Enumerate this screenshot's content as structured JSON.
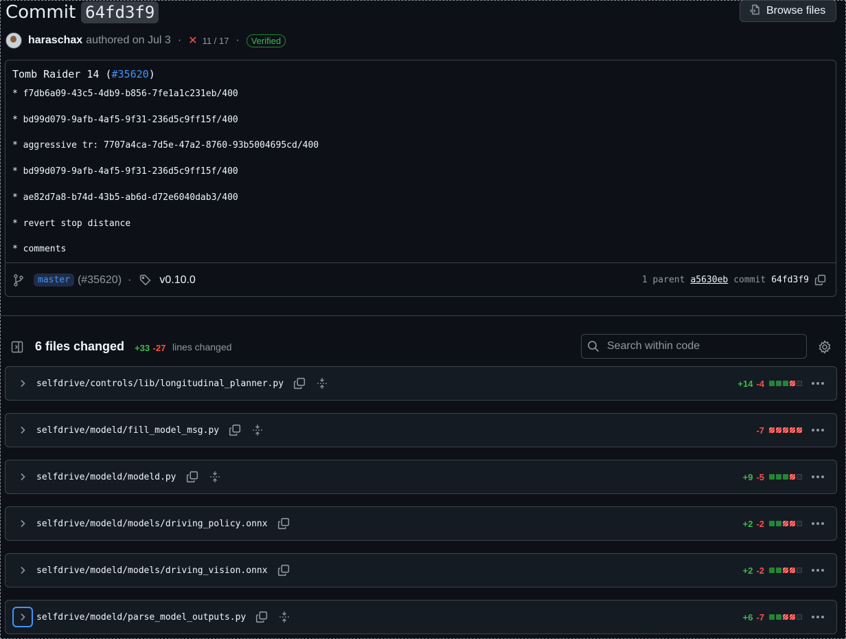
{
  "header": {
    "title_prefix": "Commit",
    "sha": "64fd3f9",
    "browse_files": "Browse files"
  },
  "meta": {
    "author": "haraschax",
    "authored": "authored on Jul 3",
    "checks": "11 / 17",
    "verified": "Verified"
  },
  "message": {
    "title_text": "Tomb Raider 14 (",
    "pr_link": "#35620",
    "title_close": ")",
    "lines": [
      "* f7db6a09-43c5-4db9-b856-7fe1a1c231eb/400",
      "* bd99d079-9afb-4af5-9f31-236d5c9ff15f/400",
      "* aggressive tr: 7707a4ca-7d5e-47a2-8760-93b5004695cd/400",
      "* bd99d079-9afb-4af5-9f31-236d5c9ff15f/400",
      "* ae82d7a8-b74d-43b5-ab6d-d72e6040dab3/400",
      "* revert stop distance",
      "* comments"
    ]
  },
  "footer": {
    "branch": "master",
    "pr_ref": "(#35620)",
    "tag": "v0.10.0",
    "parent_label": "1 parent",
    "parent_sha": "a5630eb",
    "commit_label": "commit",
    "commit_sha": "64fd3f9"
  },
  "files_toolbar": {
    "count_label": "6 files changed",
    "additions": "+33",
    "deletions": "-27",
    "lines_changed": "lines changed",
    "search_placeholder": "Search within code"
  },
  "files": [
    {
      "path": "selfdrive/controls/lib/longitudinal_planner.py",
      "add": "+14",
      "del": "-4",
      "bar": [
        "a",
        "a",
        "a",
        "d",
        "n"
      ],
      "expandable": true
    },
    {
      "path": "selfdrive/modeld/fill_model_msg.py",
      "add": "",
      "del": "-7",
      "bar": [
        "d",
        "d",
        "d",
        "d",
        "d"
      ],
      "expandable": true
    },
    {
      "path": "selfdrive/modeld/modeld.py",
      "add": "+9",
      "del": "-5",
      "bar": [
        "a",
        "a",
        "a",
        "d",
        "n"
      ],
      "expandable": true
    },
    {
      "path": "selfdrive/modeld/models/driving_policy.onnx",
      "add": "+2",
      "del": "-2",
      "bar": [
        "a",
        "a",
        "d",
        "d",
        "n"
      ],
      "expandable": false
    },
    {
      "path": "selfdrive/modeld/models/driving_vision.onnx",
      "add": "+2",
      "del": "-2",
      "bar": [
        "a",
        "a",
        "d",
        "d",
        "n"
      ],
      "expandable": false
    },
    {
      "path": "selfdrive/modeld/parse_model_outputs.py",
      "add": "+6",
      "del": "-7",
      "bar": [
        "a",
        "a",
        "d",
        "d",
        "n"
      ],
      "expandable": true
    }
  ],
  "colors": {
    "background": "#0d1117",
    "border": "#3d444d",
    "accent": "#4493f8",
    "added": "#3fb950",
    "deleted": "#f85149"
  }
}
